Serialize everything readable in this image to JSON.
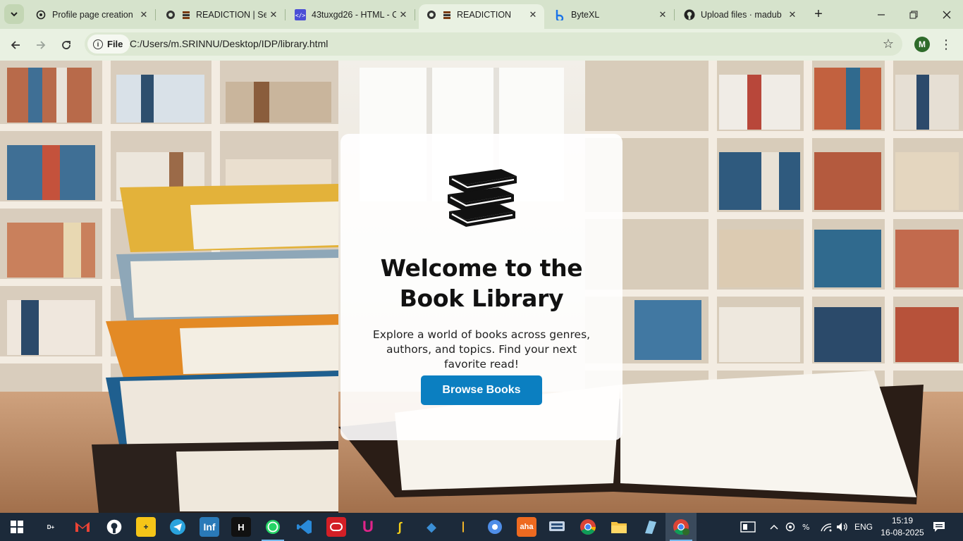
{
  "browser": {
    "tabs": [
      {
        "title": "Profile page creation",
        "icon": "openai-icon"
      },
      {
        "title": "READICTION | Set",
        "icon": "globe-books-icon"
      },
      {
        "title": "43tuxgd26 - HTML - C",
        "icon": "code-icon"
      },
      {
        "title": "READICTION",
        "icon": "globe-books-icon",
        "active": true
      },
      {
        "title": "ByteXL",
        "icon": "bytexl-icon"
      },
      {
        "title": "Upload files · madub",
        "icon": "github-icon"
      }
    ],
    "address": {
      "scheme_label": "File",
      "url": "C:/Users/m.SRINNU/Desktop/IDP/library.html"
    },
    "profile_initial": "M",
    "accent": "#d6e3cc"
  },
  "page": {
    "heading": "Welcome to the Book Library",
    "description": "Explore a world of books across genres, authors, and topics. Find your next favorite read!",
    "button_label": "Browse Books",
    "button_color": "#0b7fc1"
  },
  "taskbar": {
    "apps": [
      "disney-hotstar",
      "gmail",
      "github",
      "app-store-plus",
      "telegram",
      "infosys",
      "hackerrank",
      "whatsapp",
      "vscode",
      "oracle",
      "udemy",
      "kite",
      "msft-azure",
      "idea",
      "chromium",
      "aha",
      "vpn",
      "chrome",
      "file-explorer",
      "notes",
      "chrome-profile"
    ],
    "language": "ENG",
    "time": "15:19",
    "date": "16-08-2025"
  }
}
